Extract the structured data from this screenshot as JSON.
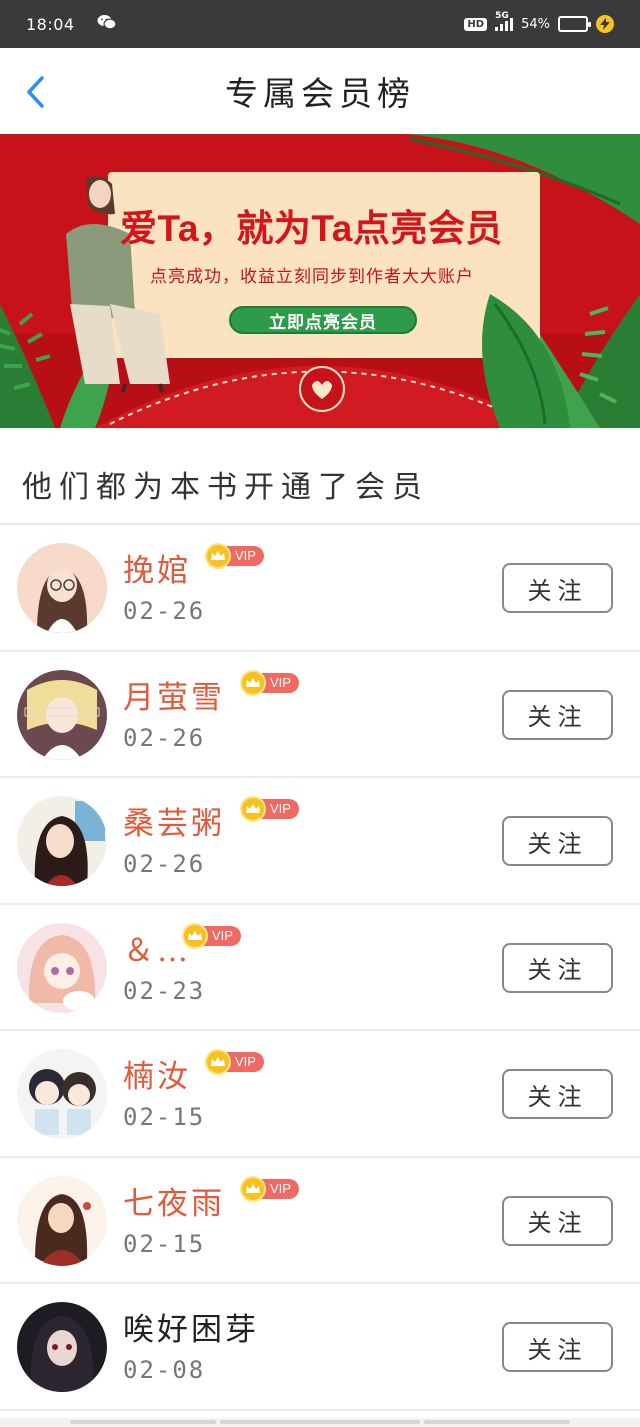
{
  "status_bar": {
    "time": "18:04",
    "network_type": "5G",
    "hd_label": "HD",
    "battery_percent": "54%",
    "battery_level": 0.54,
    "icons": [
      "wechat-icon",
      "signal-icon",
      "battery-icon",
      "charging-icon"
    ]
  },
  "header": {
    "title": "专属会员榜",
    "back_icon": "chevron-left-icon",
    "accent_color": "#2a8ff7"
  },
  "banner": {
    "title": "爱Ta，就为Ta点亮会员",
    "subtitle": "点亮成功，收益立刻同步到作者大大账户",
    "cta_label": "立即点亮会员",
    "colors": {
      "background": "#c8121a",
      "card": "#fbe3c2",
      "cta": "#2d9b4a",
      "leaf": "#2f8d3e"
    }
  },
  "section": {
    "title": "他们都为本书开通了会员"
  },
  "members": [
    {
      "name": "挽婠",
      "vip": true,
      "vip_label": "VIP",
      "date": "02-26",
      "follow_label": "关注",
      "avatar_theme": "girl-glasses"
    },
    {
      "name": "月萤雪",
      "vip": true,
      "vip_label": "VIP",
      "date": "02-26",
      "follow_label": "关注",
      "avatar_theme": "anime-blonde"
    },
    {
      "name": "桑芸粥",
      "vip": true,
      "vip_label": "VIP",
      "date": "02-26",
      "follow_label": "关注",
      "avatar_theme": "girl-dark-hair"
    },
    {
      "name": "＆…",
      "vip": true,
      "vip_label": "VIP",
      "date": "02-23",
      "follow_label": "关注",
      "avatar_theme": "pink-girl"
    },
    {
      "name": "楠汝",
      "vip": true,
      "vip_label": "VIP",
      "date": "02-15",
      "follow_label": "关注",
      "avatar_theme": "chibi-pair"
    },
    {
      "name": "七夜雨",
      "vip": true,
      "vip_label": "VIP",
      "date": "02-15",
      "follow_label": "关注",
      "avatar_theme": "ancient-girl"
    },
    {
      "name": "唉好困芽",
      "vip": false,
      "date": "02-08",
      "follow_label": "关注",
      "avatar_theme": "dark-anime"
    }
  ]
}
